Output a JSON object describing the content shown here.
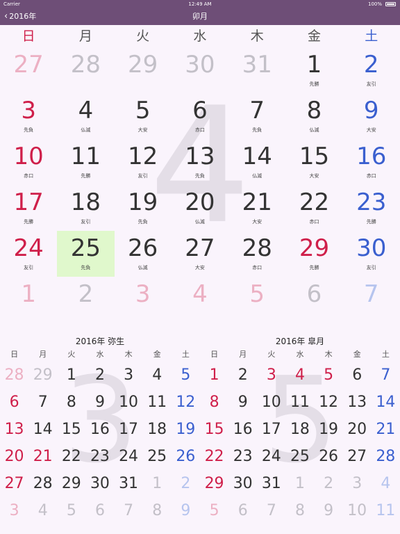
{
  "status": {
    "carrier": "Carrier",
    "time": "12:49 AM",
    "battery": "100%"
  },
  "nav": {
    "back_label": "2016年",
    "title": "卯月"
  },
  "main": {
    "watermark": "4",
    "weekdays": [
      "日",
      "月",
      "火",
      "水",
      "木",
      "金",
      "土"
    ],
    "weeks": [
      [
        {
          "d": "27",
          "r": "",
          "s": "red-o"
        },
        {
          "d": "28",
          "r": "",
          "s": "gray-o"
        },
        {
          "d": "29",
          "r": "",
          "s": "gray-o"
        },
        {
          "d": "30",
          "r": "",
          "s": "gray-o"
        },
        {
          "d": "31",
          "r": "",
          "s": "gray-o"
        },
        {
          "d": "1",
          "r": "先勝",
          "s": "dark"
        },
        {
          "d": "2",
          "r": "友引",
          "s": "blue"
        }
      ],
      [
        {
          "d": "3",
          "r": "先負",
          "s": "red"
        },
        {
          "d": "4",
          "r": "仏滅",
          "s": "dark"
        },
        {
          "d": "5",
          "r": "大安",
          "s": "dark"
        },
        {
          "d": "6",
          "r": "赤口",
          "s": "dark"
        },
        {
          "d": "7",
          "r": "先負",
          "s": "dark"
        },
        {
          "d": "8",
          "r": "仏滅",
          "s": "dark"
        },
        {
          "d": "9",
          "r": "大安",
          "s": "blue"
        }
      ],
      [
        {
          "d": "10",
          "r": "赤口",
          "s": "red"
        },
        {
          "d": "11",
          "r": "先勝",
          "s": "dark"
        },
        {
          "d": "12",
          "r": "友引",
          "s": "dark"
        },
        {
          "d": "13",
          "r": "先負",
          "s": "dark"
        },
        {
          "d": "14",
          "r": "仏滅",
          "s": "dark"
        },
        {
          "d": "15",
          "r": "大安",
          "s": "dark"
        },
        {
          "d": "16",
          "r": "赤口",
          "s": "blue"
        }
      ],
      [
        {
          "d": "17",
          "r": "先勝",
          "s": "red"
        },
        {
          "d": "18",
          "r": "友引",
          "s": "dark"
        },
        {
          "d": "19",
          "r": "先負",
          "s": "dark"
        },
        {
          "d": "20",
          "r": "仏滅",
          "s": "dark"
        },
        {
          "d": "21",
          "r": "大安",
          "s": "dark"
        },
        {
          "d": "22",
          "r": "赤口",
          "s": "dark"
        },
        {
          "d": "23",
          "r": "先勝",
          "s": "blue"
        }
      ],
      [
        {
          "d": "24",
          "r": "友引",
          "s": "red"
        },
        {
          "d": "25",
          "r": "先負",
          "s": "dark",
          "today": true
        },
        {
          "d": "26",
          "r": "仏滅",
          "s": "dark"
        },
        {
          "d": "27",
          "r": "大安",
          "s": "dark"
        },
        {
          "d": "28",
          "r": "赤口",
          "s": "dark"
        },
        {
          "d": "29",
          "r": "先勝",
          "s": "red"
        },
        {
          "d": "30",
          "r": "友引",
          "s": "blue"
        }
      ],
      [
        {
          "d": "1",
          "r": "",
          "s": "red-o"
        },
        {
          "d": "2",
          "r": "",
          "s": "gray-o"
        },
        {
          "d": "3",
          "r": "",
          "s": "red-o"
        },
        {
          "d": "4",
          "r": "",
          "s": "red-o"
        },
        {
          "d": "5",
          "r": "",
          "s": "red-o"
        },
        {
          "d": "6",
          "r": "",
          "s": "gray-o"
        },
        {
          "d": "7",
          "r": "",
          "s": "blue-o"
        }
      ]
    ]
  },
  "prev_month": {
    "title": "2016年 弥生",
    "watermark": "3",
    "weekdays": [
      "日",
      "月",
      "火",
      "水",
      "木",
      "金",
      "土"
    ],
    "weeks": [
      [
        {
          "d": "28",
          "s": "red-o"
        },
        {
          "d": "29",
          "s": "gray-o"
        },
        {
          "d": "1",
          "s": "dark"
        },
        {
          "d": "2",
          "s": "dark"
        },
        {
          "d": "3",
          "s": "dark"
        },
        {
          "d": "4",
          "s": "dark"
        },
        {
          "d": "5",
          "s": "blue"
        }
      ],
      [
        {
          "d": "6",
          "s": "red"
        },
        {
          "d": "7",
          "s": "dark"
        },
        {
          "d": "8",
          "s": "dark"
        },
        {
          "d": "9",
          "s": "dark"
        },
        {
          "d": "10",
          "s": "dark"
        },
        {
          "d": "11",
          "s": "dark"
        },
        {
          "d": "12",
          "s": "blue"
        }
      ],
      [
        {
          "d": "13",
          "s": "red"
        },
        {
          "d": "14",
          "s": "dark"
        },
        {
          "d": "15",
          "s": "dark"
        },
        {
          "d": "16",
          "s": "dark"
        },
        {
          "d": "17",
          "s": "dark"
        },
        {
          "d": "18",
          "s": "dark"
        },
        {
          "d": "19",
          "s": "blue"
        }
      ],
      [
        {
          "d": "20",
          "s": "red"
        },
        {
          "d": "21",
          "s": "red"
        },
        {
          "d": "22",
          "s": "dark"
        },
        {
          "d": "23",
          "s": "dark"
        },
        {
          "d": "24",
          "s": "dark"
        },
        {
          "d": "25",
          "s": "dark"
        },
        {
          "d": "26",
          "s": "blue"
        }
      ],
      [
        {
          "d": "27",
          "s": "red"
        },
        {
          "d": "28",
          "s": "dark"
        },
        {
          "d": "29",
          "s": "dark"
        },
        {
          "d": "30",
          "s": "dark"
        },
        {
          "d": "31",
          "s": "dark"
        },
        {
          "d": "1",
          "s": "gray-o"
        },
        {
          "d": "2",
          "s": "blue-o"
        }
      ],
      [
        {
          "d": "3",
          "s": "red-o"
        },
        {
          "d": "4",
          "s": "gray-o"
        },
        {
          "d": "5",
          "s": "gray-o"
        },
        {
          "d": "6",
          "s": "gray-o"
        },
        {
          "d": "7",
          "s": "gray-o"
        },
        {
          "d": "8",
          "s": "gray-o"
        },
        {
          "d": "9",
          "s": "blue-o"
        }
      ]
    ]
  },
  "next_month": {
    "title": "2016年 皐月",
    "watermark": "5",
    "weekdays": [
      "日",
      "月",
      "火",
      "水",
      "木",
      "金",
      "土"
    ],
    "weeks": [
      [
        {
          "d": "1",
          "s": "red"
        },
        {
          "d": "2",
          "s": "dark"
        },
        {
          "d": "3",
          "s": "red"
        },
        {
          "d": "4",
          "s": "red"
        },
        {
          "d": "5",
          "s": "red"
        },
        {
          "d": "6",
          "s": "dark"
        },
        {
          "d": "7",
          "s": "blue"
        }
      ],
      [
        {
          "d": "8",
          "s": "red"
        },
        {
          "d": "9",
          "s": "dark"
        },
        {
          "d": "10",
          "s": "dark"
        },
        {
          "d": "11",
          "s": "dark"
        },
        {
          "d": "12",
          "s": "dark"
        },
        {
          "d": "13",
          "s": "dark"
        },
        {
          "d": "14",
          "s": "blue"
        }
      ],
      [
        {
          "d": "15",
          "s": "red"
        },
        {
          "d": "16",
          "s": "dark"
        },
        {
          "d": "17",
          "s": "dark"
        },
        {
          "d": "18",
          "s": "dark"
        },
        {
          "d": "19",
          "s": "dark"
        },
        {
          "d": "20",
          "s": "dark"
        },
        {
          "d": "21",
          "s": "blue"
        }
      ],
      [
        {
          "d": "22",
          "s": "red"
        },
        {
          "d": "23",
          "s": "dark"
        },
        {
          "d": "24",
          "s": "dark"
        },
        {
          "d": "25",
          "s": "dark"
        },
        {
          "d": "26",
          "s": "dark"
        },
        {
          "d": "27",
          "s": "dark"
        },
        {
          "d": "28",
          "s": "blue"
        }
      ],
      [
        {
          "d": "29",
          "s": "red"
        },
        {
          "d": "30",
          "s": "dark"
        },
        {
          "d": "31",
          "s": "dark"
        },
        {
          "d": "1",
          "s": "gray-o"
        },
        {
          "d": "2",
          "s": "gray-o"
        },
        {
          "d": "3",
          "s": "gray-o"
        },
        {
          "d": "4",
          "s": "blue-o"
        }
      ],
      [
        {
          "d": "5",
          "s": "red-o"
        },
        {
          "d": "6",
          "s": "gray-o"
        },
        {
          "d": "7",
          "s": "gray-o"
        },
        {
          "d": "8",
          "s": "gray-o"
        },
        {
          "d": "9",
          "s": "gray-o"
        },
        {
          "d": "10",
          "s": "gray-o"
        },
        {
          "d": "11",
          "s": "blue-o"
        }
      ]
    ]
  }
}
